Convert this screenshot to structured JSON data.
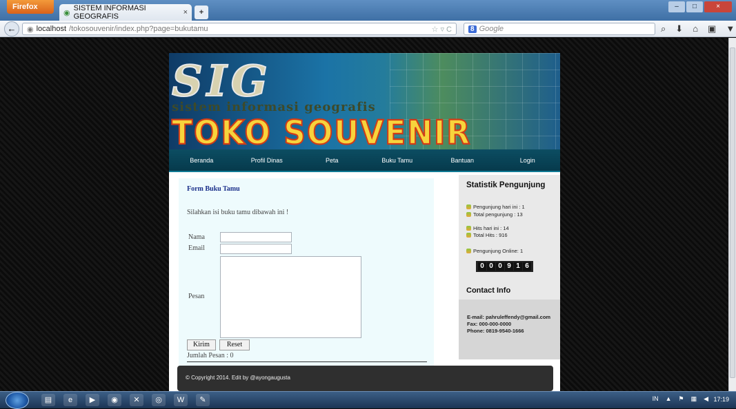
{
  "browser": {
    "menu_label": "Firefox",
    "tab_title": "SISTEM INFORMASI GEOGRAFIS",
    "new_tab": "+",
    "url_host": "localhost",
    "url_path": "/tokosouvenir/index.php?page=bukutamu",
    "search_placeholder": "Google",
    "search_engine": "8"
  },
  "site": {
    "banner_logo": "SIG",
    "banner_subtitle": "sistem informasi geografis",
    "banner_title": "TOKO SOUVENIR",
    "menu": [
      "Beranda",
      "Profil Dinas",
      "Peta",
      "Buku Tamu",
      "Bantuan",
      "Login"
    ]
  },
  "form": {
    "title": "Form Buku Tamu",
    "intro": "Silahkan isi buku tamu dibawah ini !",
    "name_label": "Nama",
    "email_label": "Email",
    "message_label": "Pesan",
    "submit_label": "Kirim",
    "reset_label": "Reset",
    "message_count": "Jumlah Pesan : 0"
  },
  "stats": {
    "heading": "Statistik Pengunjung",
    "today_visitors": "Pengunjung hari ini : 1",
    "total_visitors": "Total pengunjung : 13",
    "hits_today": "Hits hari ini : 14",
    "total_hits": "Total Hits : 916",
    "online": "Pengunjung Online: 1",
    "counter_digits": [
      "0",
      "0",
      "0",
      "9",
      "1",
      "6"
    ]
  },
  "contact": {
    "heading": "Contact Info",
    "email": "E-mail: pahruleffendy@gmail.com",
    "fax": "Fax:   000-000-0000",
    "phone": "Phone: 0819-9540-1666"
  },
  "footer": {
    "copyright": "© Copyright 2014. Edit by @ayongaugusta"
  },
  "taskbar": {
    "lang": "IN",
    "clock": "17:19"
  },
  "colors": {
    "menu_bg": "#063a4c",
    "form_bg": "#eefbfd",
    "sidebar_bg": "#e9e9e9",
    "footer_bg": "#2f2f2f"
  }
}
